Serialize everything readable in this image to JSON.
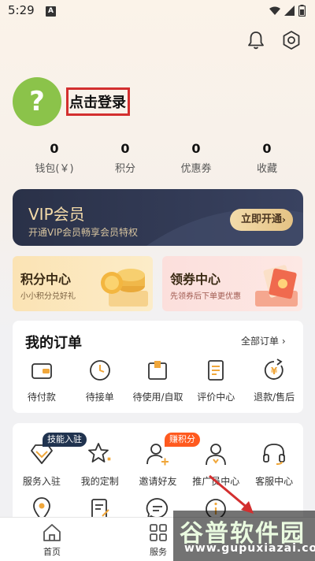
{
  "status_bar": {
    "time": "5:29",
    "app_icon": "A"
  },
  "header": {
    "bell_icon": "bell-icon",
    "settings_icon": "gear-icon"
  },
  "profile": {
    "avatar_glyph": "?",
    "login_label": "点击登录"
  },
  "stats": [
    {
      "value": "0",
      "label": "钱包(￥)"
    },
    {
      "value": "0",
      "label": "积分"
    },
    {
      "value": "0",
      "label": "优惠券"
    },
    {
      "value": "0",
      "label": "收藏"
    }
  ],
  "vip": {
    "title": "VIP会员",
    "subtitle": "开通VIP会员畅享会员特权",
    "button": "立即开通"
  },
  "promos": [
    {
      "title": "积分中心",
      "subtitle": "小小积分兑好礼"
    },
    {
      "title": "领券中心",
      "subtitle": "先领券后下单更优惠"
    }
  ],
  "orders": {
    "title": "我的订单",
    "all_label": "全部订单",
    "items": [
      {
        "label": "待付款",
        "icon": "wallet-icon"
      },
      {
        "label": "待接单",
        "icon": "clock-icon"
      },
      {
        "label": "待使用/自取",
        "icon": "package-icon"
      },
      {
        "label": "评价中心",
        "icon": "document-icon"
      },
      {
        "label": "退款/售后",
        "icon": "refund-icon"
      }
    ]
  },
  "services": {
    "row1": [
      {
        "label": "服务入驻",
        "icon": "diamond-icon"
      },
      {
        "label": "我的定制",
        "icon": "star-icon"
      },
      {
        "label": "邀请好友",
        "icon": "add-user-icon"
      },
      {
        "label": "推广员中心",
        "icon": "user-icon"
      },
      {
        "label": "客服中心",
        "icon": "headset-icon"
      }
    ],
    "badges": {
      "skill": "技能入驻",
      "points": "赚积分"
    }
  },
  "tabbar": {
    "home": "首页",
    "service": "服务"
  },
  "watermark": {
    "text": "谷普软件园",
    "url": "www.gupuxiazai.com"
  },
  "colors": {
    "accent_red": "#d32f2f",
    "vip_gold": "#f4dba9",
    "badge_orange": "#ff5a1f",
    "avatar_green": "#8bc34a"
  }
}
